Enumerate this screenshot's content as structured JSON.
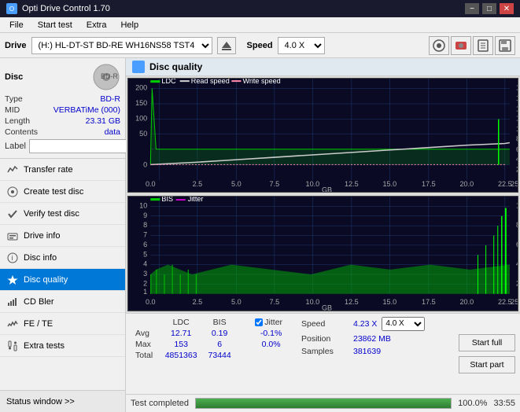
{
  "titlebar": {
    "title": "Opti Drive Control 1.70",
    "icon": "O",
    "minimize": "−",
    "maximize": "□",
    "close": "✕"
  },
  "menubar": {
    "items": [
      "File",
      "Start test",
      "Extra",
      "Help"
    ]
  },
  "drivebar": {
    "drive_label": "Drive",
    "drive_value": "(H:) HL-DT-ST BD-RE  WH16NS58 TST4",
    "speed_label": "Speed",
    "speed_value": "4.0 X"
  },
  "disc": {
    "title": "Disc",
    "type_label": "Type",
    "type_value": "BD-R",
    "mid_label": "MID",
    "mid_value": "VERBATiMe (000)",
    "length_label": "Length",
    "length_value": "23.31 GB",
    "contents_label": "Contents",
    "contents_value": "data",
    "label_label": "Label"
  },
  "nav": {
    "items": [
      {
        "id": "transfer-rate",
        "label": "Transfer rate",
        "icon": "📈"
      },
      {
        "id": "create-test-disc",
        "label": "Create test disc",
        "icon": "💿"
      },
      {
        "id": "verify-test-disc",
        "label": "Verify test disc",
        "icon": "✔"
      },
      {
        "id": "drive-info",
        "label": "Drive info",
        "icon": "ℹ"
      },
      {
        "id": "disc-info",
        "label": "Disc info",
        "icon": "📄"
      },
      {
        "id": "disc-quality",
        "label": "Disc quality",
        "icon": "⭐",
        "active": true
      },
      {
        "id": "cd-bler",
        "label": "CD Bler",
        "icon": "📊"
      },
      {
        "id": "fe-te",
        "label": "FE / TE",
        "icon": "📉"
      },
      {
        "id": "extra-tests",
        "label": "Extra tests",
        "icon": "🔬"
      }
    ],
    "status_window": "Status window >>"
  },
  "chart": {
    "title": "Disc quality",
    "icon_color": "#4a9eff",
    "legend_top": {
      "ldc_label": "LDC",
      "read_speed_label": "Read speed",
      "write_speed_label": "Write speed"
    },
    "legend_bottom": {
      "bis_label": "BIS",
      "jitter_label": "Jitter"
    },
    "top_chart": {
      "y_left_max": 200,
      "y_right_max": 18,
      "x_max": 25,
      "grid_color": "#2a2a5a",
      "bg_color": "#1a1a3a"
    },
    "bottom_chart": {
      "y_left_max": 10,
      "y_right_max": 10,
      "x_max": 25,
      "bg_color": "#1a1a3a"
    }
  },
  "stats": {
    "columns": [
      "",
      "LDC",
      "BIS",
      "",
      "Jitter",
      "Speed",
      "4.23 X",
      "4.0 X"
    ],
    "rows": [
      {
        "label": "Avg",
        "ldc": "12.71",
        "bis": "0.19",
        "jitter": "-0.1%"
      },
      {
        "label": "Max",
        "ldc": "153",
        "bis": "6",
        "jitter": "0.0%"
      },
      {
        "label": "Total",
        "ldc": "4851363",
        "bis": "73444",
        "jitter": ""
      }
    ],
    "jitter_checked": true,
    "jitter_label": "Jitter",
    "speed_label": "Speed",
    "speed_val": "4.23 X",
    "speed_select": "4.0 X",
    "position_label": "Position",
    "position_val": "23862 MB",
    "samples_label": "Samples",
    "samples_val": "381639",
    "btn_start_full": "Start full",
    "btn_start_part": "Start part"
  },
  "progress": {
    "status": "Test completed",
    "percent": 100,
    "percent_text": "100.0%",
    "time": "33:55",
    "bar_color": "#4caf50"
  },
  "colors": {
    "ldc_line": "#00ff00",
    "bis_bars": "#00ff00",
    "read_speed": "#ffffff",
    "jitter_line": "#ff00ff",
    "grid": "#2a4070",
    "bg": "#0a0a2a",
    "axis_text": "#cccccc",
    "accent": "#0078d7"
  }
}
